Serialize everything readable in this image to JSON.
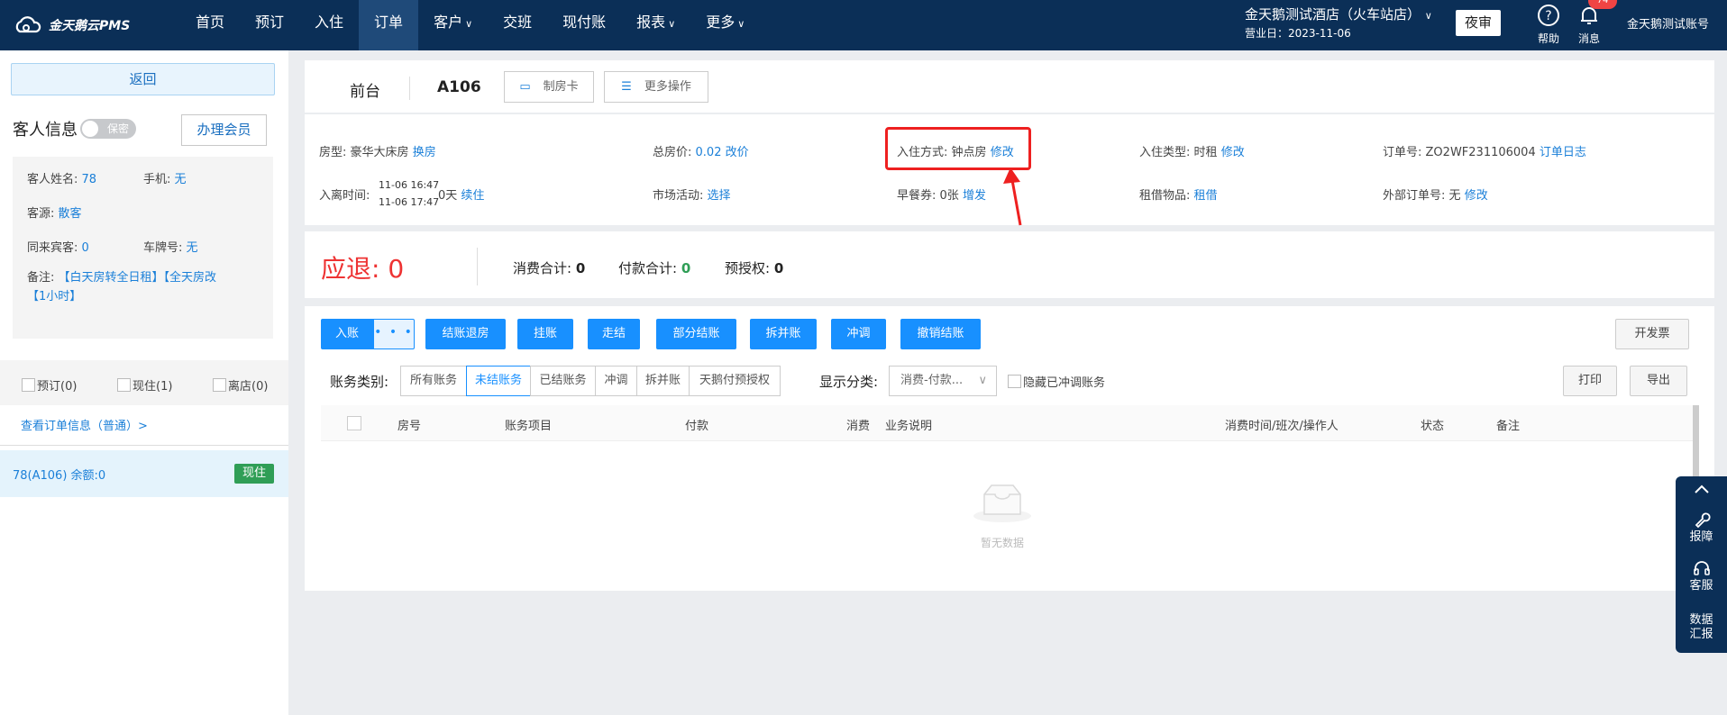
{
  "top": {
    "logo_text": "金天鹅云PMS",
    "nav": [
      {
        "label": "首页",
        "chev": false
      },
      {
        "label": "预订",
        "chev": false
      },
      {
        "label": "入住",
        "chev": false
      },
      {
        "label": "订单",
        "chev": false,
        "active": true
      },
      {
        "label": "客户",
        "chev": true
      },
      {
        "label": "交班",
        "chev": false
      },
      {
        "label": "现付账",
        "chev": false
      },
      {
        "label": "报表",
        "chev": true
      },
      {
        "label": "更多",
        "chev": true
      }
    ],
    "hotel": "金天鹅测试酒店（火车站店）",
    "business_date": "营业日：2023-11-06",
    "audit": "夜审",
    "help": "帮助",
    "messages": "消息",
    "message_count": "74",
    "account": "金天鹅测试账号"
  },
  "left": {
    "back": "返回",
    "guest_title": "客人信息",
    "privacy": "保密",
    "member_btn": "办理会员",
    "name_label": "客人姓名:",
    "name": "78",
    "phone_label": "手机:",
    "phone": "无",
    "source_label": "客源:",
    "source": "散客",
    "companions_label": "同来宾客:",
    "companions": "0",
    "plate_label": "车牌号:",
    "plate": "无",
    "remark_label": "备注:",
    "remark": "【白天房转全日租】【全天房改【1小时】",
    "tab_booking": "预订(0)",
    "tab_staying": "现住(1)",
    "tab_left": "离店(0)",
    "order_link": "查看订单信息（普通）>",
    "room_item": "78(A106)   余额:0",
    "room_status": "现住"
  },
  "header": {
    "front": "前台",
    "room": "A106",
    "make_card": "制房卡",
    "more_ops": "更多操作"
  },
  "info": {
    "room_type_label": "房型:",
    "room_type": "豪华大床房",
    "change_room": "换房",
    "total_label": "总房价:",
    "total": "0.02",
    "change_price": "改价",
    "checkin_mode_label": "入住方式:",
    "checkin_mode": "钟点房",
    "modify": "修改",
    "checkin_type_label": "入住类型:",
    "checkin_type": "时租",
    "order_no_label": "订单号:",
    "order_no": "ZO2WF231106004",
    "order_log": "订单日志",
    "stay_label": "入离时间:",
    "stay_in": "11-06 16:47",
    "stay_out": "11-06 17:47",
    "stay_days": "0天",
    "extend": "续住",
    "market_label": "市场活动:",
    "choose": "选择",
    "breakfast_label": "早餐券:",
    "breakfast": "0张",
    "add": "增发",
    "rental_label": "租借物品:",
    "rental": "租借",
    "ext_order_label": "外部订单号:",
    "ext_order": "无"
  },
  "summary": {
    "refund_label": "应退:",
    "refund": "0",
    "consume_label": "消费合计:",
    "consume": "0",
    "pay_label": "付款合计:",
    "pay": "0",
    "preauth_label": "预授权:",
    "preauth": "0"
  },
  "billing": {
    "post": "入账",
    "dots": "• • •",
    "buttons": [
      "结账退房",
      "挂账",
      "走结",
      "部分结账",
      "拆并账",
      "冲调",
      "撤销结账"
    ],
    "invoice": "开发票",
    "category_label": "账务类别:",
    "categories": [
      "所有账务",
      "未结账务",
      "已结账务",
      "冲调",
      "拆并账",
      "天鹅付预授权"
    ],
    "display_label": "显示分类:",
    "display_value": "消费-付款...",
    "hide_offset": "隐藏已冲调账务",
    "print": "打印",
    "export": "导出",
    "columns": [
      "房号",
      "账务项目",
      "付款",
      "消费",
      "业务说明",
      "消费时间/班次/操作人",
      "状态",
      "备注"
    ],
    "empty": "暂无数据"
  },
  "tools": {
    "report": "报障",
    "service": "客服",
    "data1": "数据",
    "data2": "汇报"
  }
}
